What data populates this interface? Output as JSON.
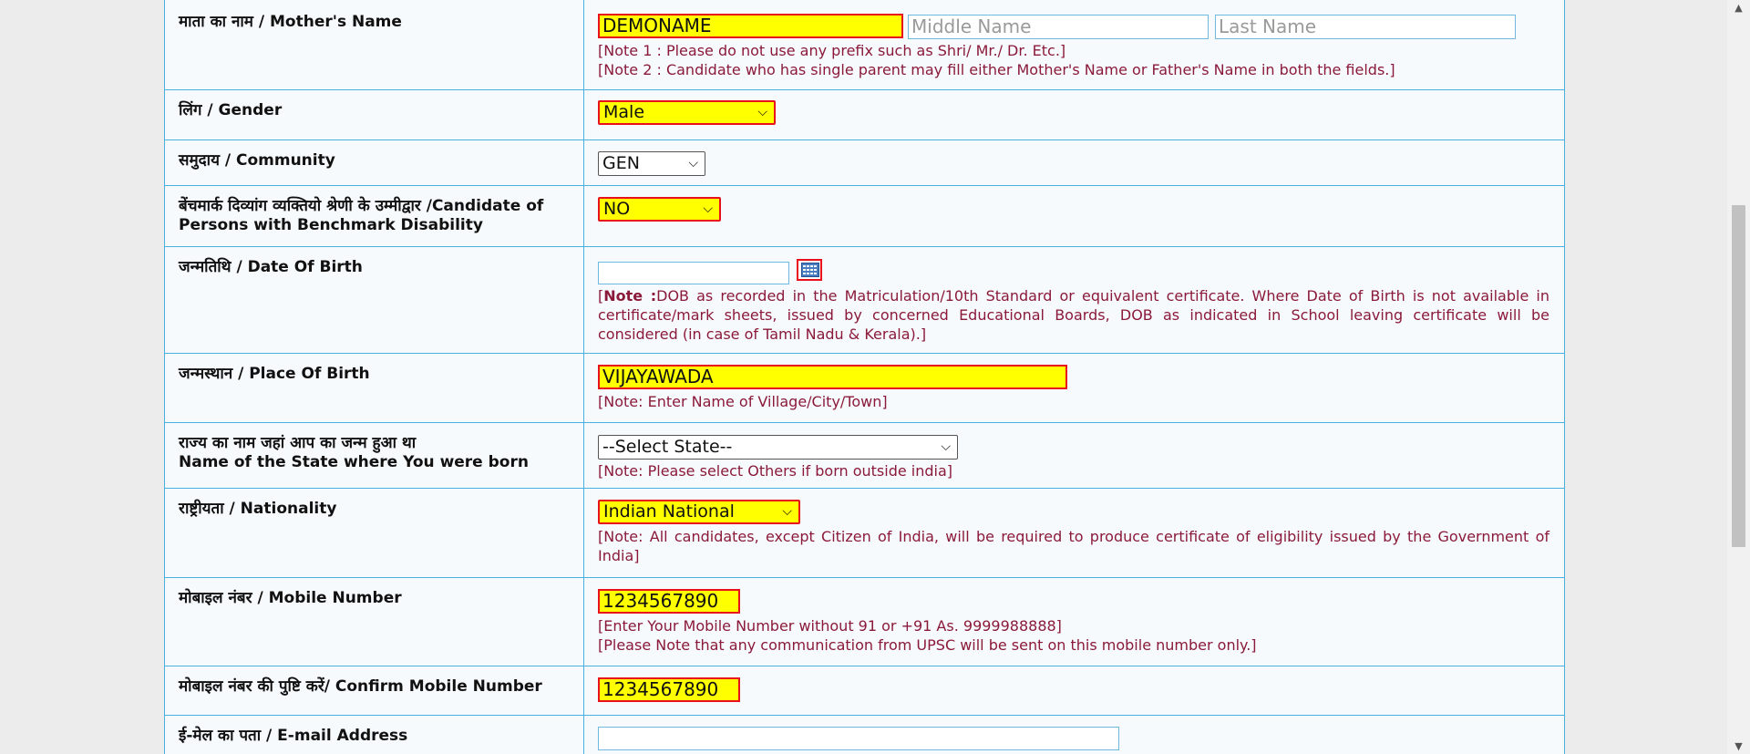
{
  "rows": [
    {
      "key": "mother",
      "label": "माता का नाम / Mother's Name",
      "first_value": "DEMONAME",
      "middle_placeholder": "Middle Name",
      "last_placeholder": "Last Name",
      "notes": [
        "[Note 1 : Please do not use any prefix such as Shri/ Mr./ Dr. Etc.]",
        "[Note 2 : Candidate who has single parent may fill either Mother's Name or Father's Name in both the fields.]"
      ]
    },
    {
      "key": "gender",
      "label": "लिंग / Gender",
      "value": "Male"
    },
    {
      "key": "community",
      "label": "समुदाय / Community",
      "value": "GEN"
    },
    {
      "key": "disability",
      "label_line1": "बेंचमार्क दिव्यांग व्यक्तियो श्रेणी के उम्मीद्वार /Candidate of",
      "label_line2": "Persons with Benchmark Disability",
      "value": "NO"
    },
    {
      "key": "dob",
      "label": "जन्मतिथि / Date Of Birth",
      "value": "",
      "note_bold": "Note :",
      "note_text": "DOB as recorded in the Matriculation/10th Standard or equivalent certificate. Where Date of Birth is not available in certificate/mark sheets, issued by concerned Educational Boards, DOB as indicated in School leaving certificate will be considered (in case of Tamil Nadu & Kerala).]",
      "note_open": "["
    },
    {
      "key": "pob",
      "label": "जन्मस्थान / Place Of Birth",
      "value": "VIJAYAWADA",
      "note": "[Note: Enter Name of Village/City/Town]"
    },
    {
      "key": "state",
      "label_line1": "राज्य का नाम जहां आप का जन्म हुआ था",
      "label_line2": "Name of the State where You were born",
      "value": "--Select State--",
      "note": "[Note: Please select Others if born outside india]"
    },
    {
      "key": "nationality",
      "label": "राष्ट्रीयता / Nationality",
      "value": "Indian National",
      "note": "[Note: All candidates, except Citizen of India, will be required to produce certificate of eligibility issued by the Government of India]"
    },
    {
      "key": "mobile",
      "label": "मोबाइल नंबर / Mobile Number",
      "value": "1234567890",
      "notes": [
        "[Enter Your Mobile Number without 91 or +91 As. 9999988888]",
        "[Please Note that any communication from UPSC will be sent on this mobile number only.]"
      ]
    },
    {
      "key": "confirm_mobile",
      "label": "मोबाइल नंबर की पुष्टि करें/ Confirm Mobile Number",
      "value": "1234567890"
    },
    {
      "key": "email",
      "label": "ई-मेल का पता / E-mail Address",
      "value": ""
    }
  ],
  "icons": {
    "calendar": "calendar-icon",
    "chevron": "chevron-down-icon"
  },
  "colors": {
    "highlight": "#ffff00",
    "highlight_border": "#e8101a",
    "note": "#8b1a3a",
    "border": "#4ab0e0"
  }
}
